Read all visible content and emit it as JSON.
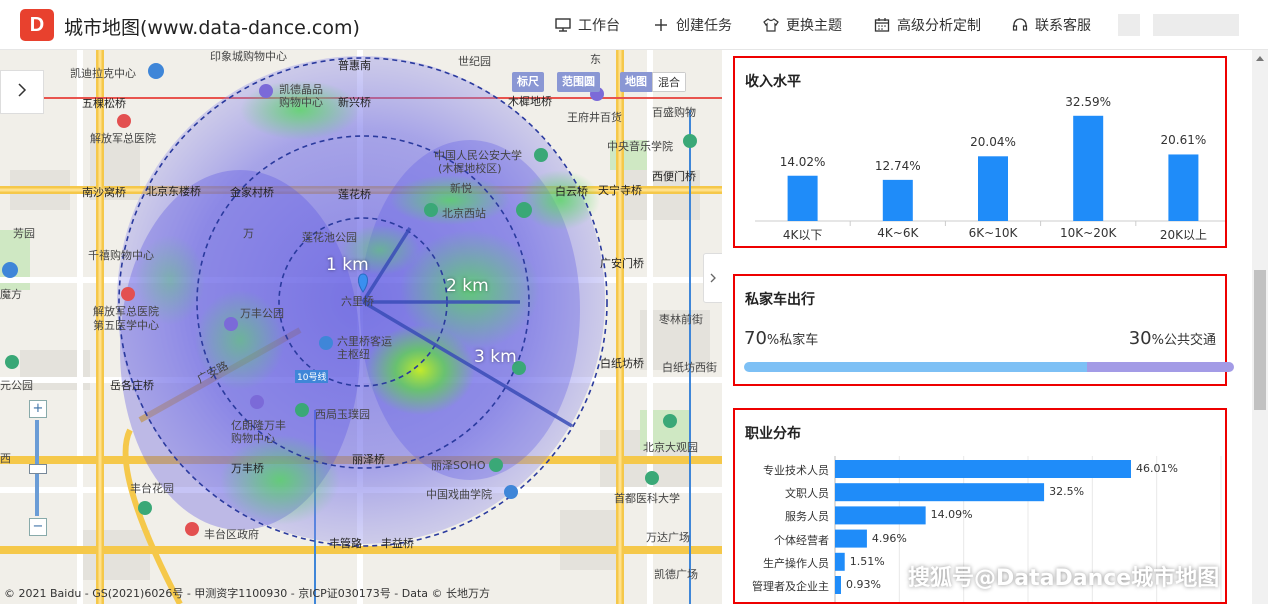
{
  "header": {
    "logo_text": "D",
    "title": "城市地图(www.data-dance.com)",
    "nav": [
      {
        "label": "工作台",
        "icon": "monitor-icon"
      },
      {
        "label": "创建任务",
        "icon": "plus-icon"
      },
      {
        "label": "更换主题",
        "icon": "shirt-icon"
      },
      {
        "label": "高级分析定制",
        "icon": "calendar-icon"
      },
      {
        "label": "联系客服",
        "icon": "headset-icon"
      }
    ]
  },
  "map": {
    "tools": [
      "标尺",
      "范围圆"
    ],
    "map_types": [
      "地图",
      "混合"
    ],
    "ring_labels": [
      "1 km",
      "2 km",
      "3 km"
    ],
    "copyright": "© 2021 Baidu - GS(2021)6026号 - 甲测资字1100930 - 京ICP证030173号 - Data © 长地万方",
    "labels": [
      "印象城购物中心",
      "普惠南",
      "世纪园",
      "东",
      "凯迪拉克中心",
      "凯德晶品",
      "购物中心",
      "新兴桥",
      "木樨地桥",
      "王府井百货",
      "百盛购物",
      "五棵松桥",
      "解放军总医院",
      "中国人民公安大学",
      "(木樨地校区)",
      "中央音乐学院",
      "西便门桥",
      "南沙窝桥",
      "北京东楼桥",
      "金家村桥",
      "莲花桥",
      "新悦",
      "白云桥",
      "天宁寺桥",
      "北京西站",
      "芳园",
      "万",
      "莲花池公园",
      "千禧购物中心",
      "广安门桥",
      "魔方",
      "解放军总医院",
      "第五医学中心",
      "万丰公园",
      "枣林前街",
      "六里桥",
      "六里桥客运",
      "主枢纽",
      "白纸坊桥",
      "白纸坊西街",
      "元公园",
      "岳各庄桥",
      "广安路",
      "10号线",
      "西局玉璞园",
      "北京大观园",
      "亿朗隆万丰",
      "购物中心",
      "万丰桥",
      "丽泽桥",
      "丽泽SOHO",
      "丰台花园",
      "中国戏曲学院",
      "首都医科大学",
      "丰台区政府",
      "万达广场",
      "丰管路",
      "丰益桥",
      "凯德广场",
      "西"
    ]
  },
  "income": {
    "title": "收入水平",
    "chart_data": {
      "type": "bar",
      "categories": [
        "4K以下",
        "4K~6K",
        "6K~10K",
        "10K~20K",
        "20K以上"
      ],
      "values": [
        14.02,
        12.74,
        20.04,
        32.59,
        20.61
      ],
      "value_labels": [
        "14.02%",
        "12.74%",
        "20.04%",
        "32.59%",
        "20.61%"
      ],
      "color": "#1f8cf9",
      "ylim": [
        0,
        35
      ],
      "grid": false
    }
  },
  "car": {
    "title": "私家车出行",
    "left_value": "70",
    "left_unit": "%私家车",
    "right_value": "30",
    "right_unit": "%公共交通",
    "private_share": 0.7,
    "colors": {
      "private": "#7dc0f5",
      "public": "#a39be6"
    }
  },
  "job": {
    "title": "职业分布",
    "chart_data": {
      "type": "bar",
      "orientation": "horizontal",
      "categories": [
        "专业技术人员",
        "文职人员",
        "服务人员",
        "个体经营者",
        "生产操作人员",
        "管理者及企业主"
      ],
      "values": [
        46.01,
        32.5,
        14.09,
        4.96,
        1.51,
        0.93
      ],
      "value_labels": [
        "46.01%",
        "32.5%",
        "14.09%",
        "4.96%",
        "1.51%",
        "0.93%"
      ],
      "color": "#1f8cf9",
      "xlim": [
        0,
        60
      ],
      "grid": true
    }
  },
  "watermark": "搜狐号@DataDance城市地图"
}
